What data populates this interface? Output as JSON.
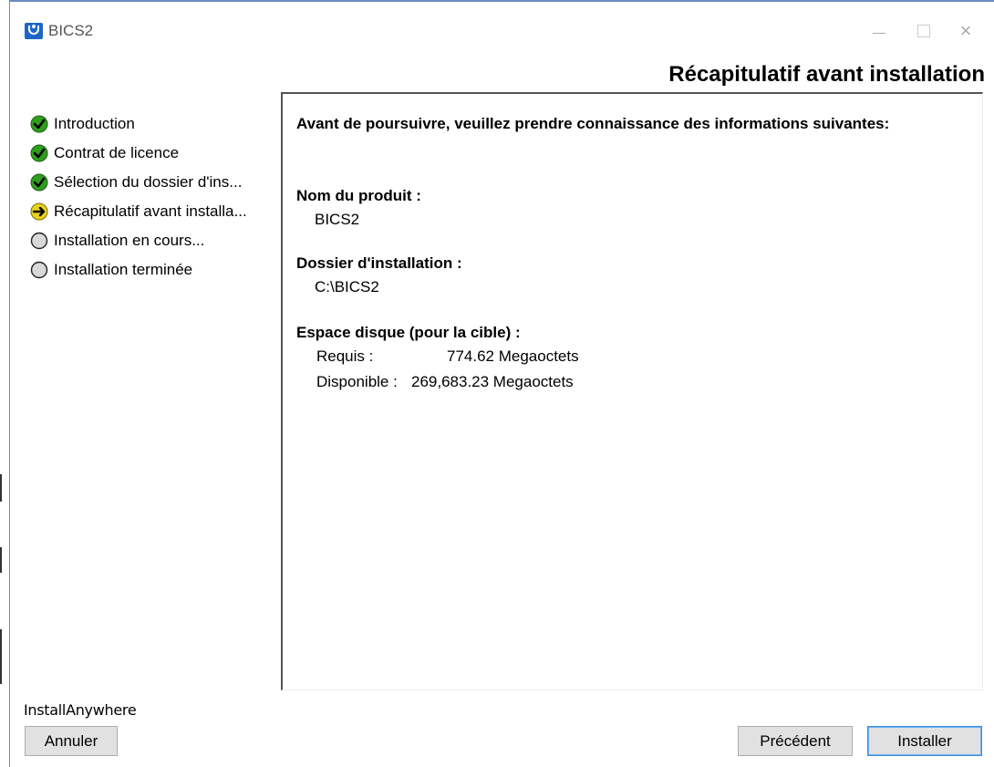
{
  "window": {
    "title": "BICS2",
    "controls": {
      "minimize": "minimize",
      "maximize": "maximize",
      "close": "×"
    }
  },
  "header": {
    "title": "Récapitulatif avant installation"
  },
  "steps": [
    {
      "label": "Introduction",
      "status": "done",
      "icon": "check-icon"
    },
    {
      "label": "Contrat de licence",
      "status": "done",
      "icon": "check-icon"
    },
    {
      "label": "Sélection du dossier d'ins...",
      "status": "done",
      "icon": "check-icon"
    },
    {
      "label": "Récapitulatif avant installa...",
      "status": "current",
      "icon": "arrow-right-icon"
    },
    {
      "label": "Installation en cours...",
      "status": "pending",
      "icon": "circle-icon"
    },
    {
      "label": "Installation terminée",
      "status": "pending",
      "icon": "circle-icon"
    }
  ],
  "content": {
    "intro": "Avant de poursuivre, veuillez prendre connaissance des informations suivantes:",
    "product_label": "Nom du produit :",
    "product_value": "BICS2",
    "folder_label": "Dossier d'installation :",
    "folder_value": "C:\\BICS2",
    "disk_label": "Espace disque (pour la cible) :",
    "required_label": "Requis :",
    "required_value": "774.62 Megaoctets",
    "available_label": "Disponible :",
    "available_value": "269,683.23 Megaoctets"
  },
  "footer": {
    "brand": "InstallAnywhere",
    "cancel_label": "Annuler",
    "previous_label": "Précédent",
    "install_label": "Installer"
  },
  "colors": {
    "done": "#2e9e1e",
    "current": "#e8d21a",
    "pending": "#d8d8d8",
    "window_border": "#6a8dc2",
    "app_icon": "#1e66c8",
    "default_button_border": "#3c8ce0"
  }
}
